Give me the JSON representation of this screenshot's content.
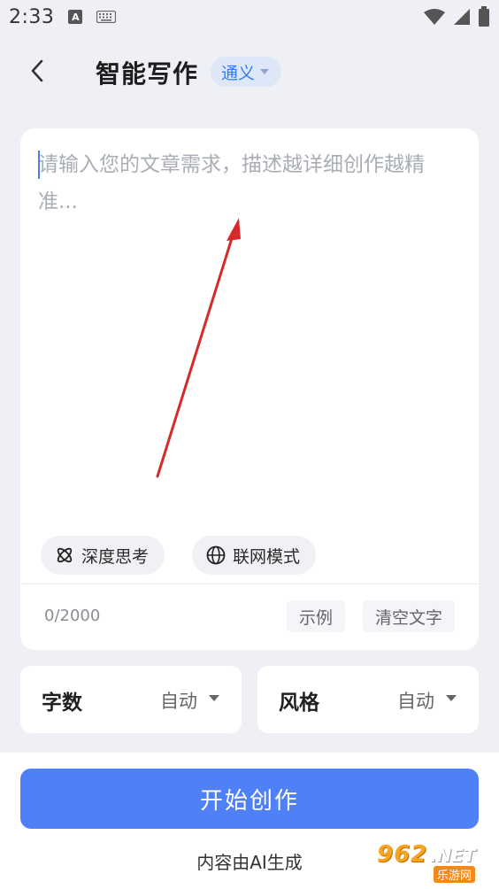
{
  "status_bar": {
    "time": "2:33",
    "notification_letter": "A",
    "icons": [
      "keyboard-icon",
      "wifi-icon",
      "signal-icon",
      "battery-icon"
    ]
  },
  "header": {
    "title": "智能写作",
    "model_selector": "通义",
    "back_icon": "chevron-left-icon"
  },
  "editor": {
    "placeholder": "请输入您的文章需求，描述越详细创作越精准...",
    "value": "",
    "modes": [
      {
        "label": "深度思考",
        "icon": "atom-icon"
      },
      {
        "label": "联网模式",
        "icon": "globe-icon"
      }
    ],
    "char_count": "0/2000",
    "example_label": "示例",
    "clear_label": "清空文字"
  },
  "options": [
    {
      "title": "字数",
      "value": "自动"
    },
    {
      "title": "风格",
      "value": "自动"
    }
  ],
  "footer": {
    "start_label": "开始创作",
    "note": "内容由AI生成"
  },
  "watermark": {
    "number": "962",
    "domain": ".NET",
    "sub": "乐游网"
  },
  "colors": {
    "background": "#eef0f5",
    "accent": "#4f80f6",
    "chip_bg": "#dde7f8",
    "chip_text": "#2f7cf6",
    "annotation_arrow": "#d42a2a"
  }
}
